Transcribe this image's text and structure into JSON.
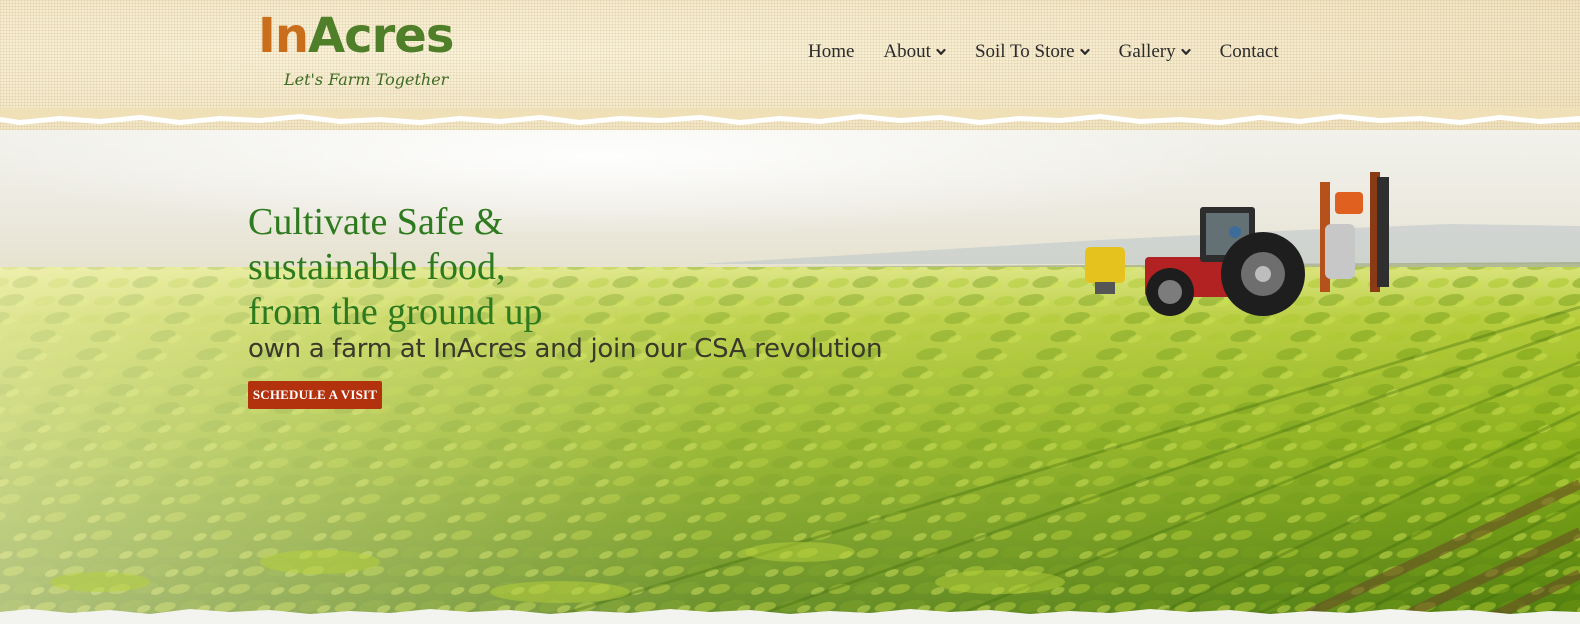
{
  "brand": {
    "name_part1": "In",
    "name_part2": "Acres",
    "tagline": "Let's Farm Together",
    "colors": {
      "brand_orange": "#c96f1c",
      "brand_green": "#4f7f28"
    }
  },
  "nav": {
    "items": [
      {
        "label": "Home",
        "has_dropdown": false
      },
      {
        "label": "About",
        "has_dropdown": true,
        "icon": "chevron-down-icon"
      },
      {
        "label": "Soil To Store",
        "has_dropdown": true,
        "icon": "chevron-down-icon"
      },
      {
        "label": "Gallery",
        "has_dropdown": true,
        "icon": "chevron-down-icon"
      },
      {
        "label": "Contact",
        "has_dropdown": false
      }
    ]
  },
  "hero": {
    "title_lines": [
      "Cultivate Safe &",
      "sustainable food,",
      "from the ground up"
    ],
    "subtitle": "own a farm at InAcres and join our CSA revolution",
    "cta_label": "SCHEDULE A VISIT",
    "colors": {
      "title": "#2e7a1f",
      "cta": "#b3320e"
    }
  }
}
